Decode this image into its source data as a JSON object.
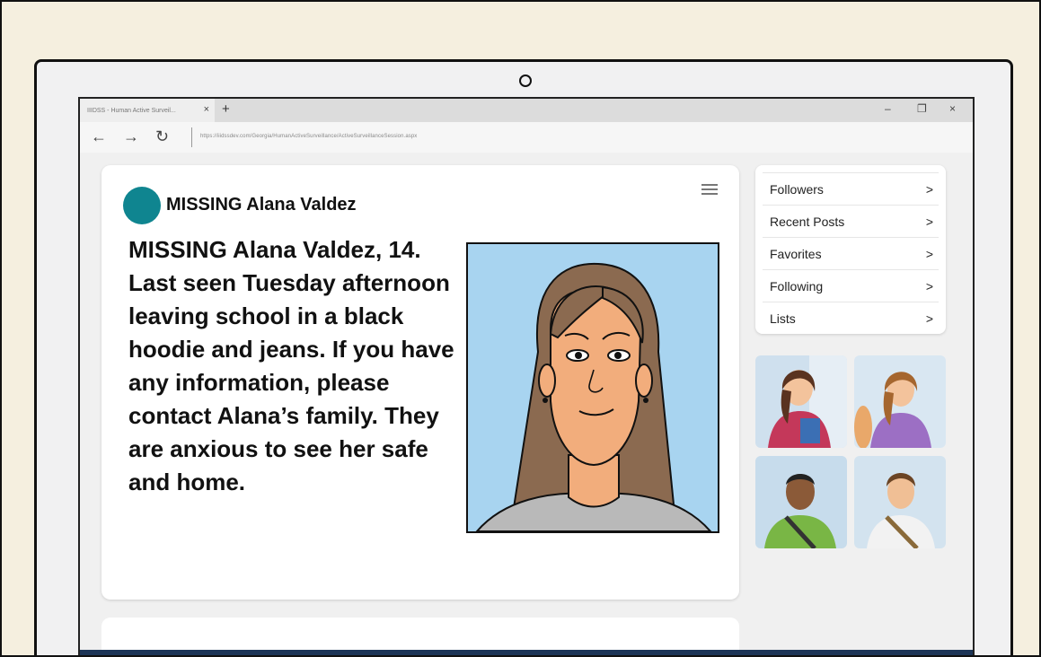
{
  "browser": {
    "tab_title": "IIIDSS - Human Active Surveil...",
    "tab_close": "×",
    "new_tab": "+",
    "minimize": "–",
    "restore": "❐",
    "close": "×",
    "back": "←",
    "forward": "→",
    "refresh": "↻",
    "url": "https://iiidssdev.com/Georgia/HumanActiveSurveillance/ActiveSurveillanceSession.aspx"
  },
  "post": {
    "title": "MISSING Alana Valdez",
    "body": "MISSING Alana Valdez, 14. Last seen Tuesday afternoon leaving school in a black hoodie and jeans. If you have any information, please contact Alana’s family. They are anxious to see her safe and home."
  },
  "sidebar": {
    "items": [
      {
        "label": "Followers",
        "arrow": ">"
      },
      {
        "label": "Recent Posts",
        "arrow": ">"
      },
      {
        "label": "Favorites",
        "arrow": ">"
      },
      {
        "label": "Following",
        "arrow": ">"
      },
      {
        "label": "Lists",
        "arrow": ">"
      }
    ]
  },
  "colors": {
    "avatar": "#0f8590",
    "portrait_bg": "#a8d4f0",
    "taskbar": "#1d3557"
  },
  "icons": {
    "menu": "hamburger-icon",
    "tray": [
      "chevron-up-icon",
      "pen-icon",
      "battery-icon",
      "signal-icon",
      "volume-icon"
    ]
  }
}
